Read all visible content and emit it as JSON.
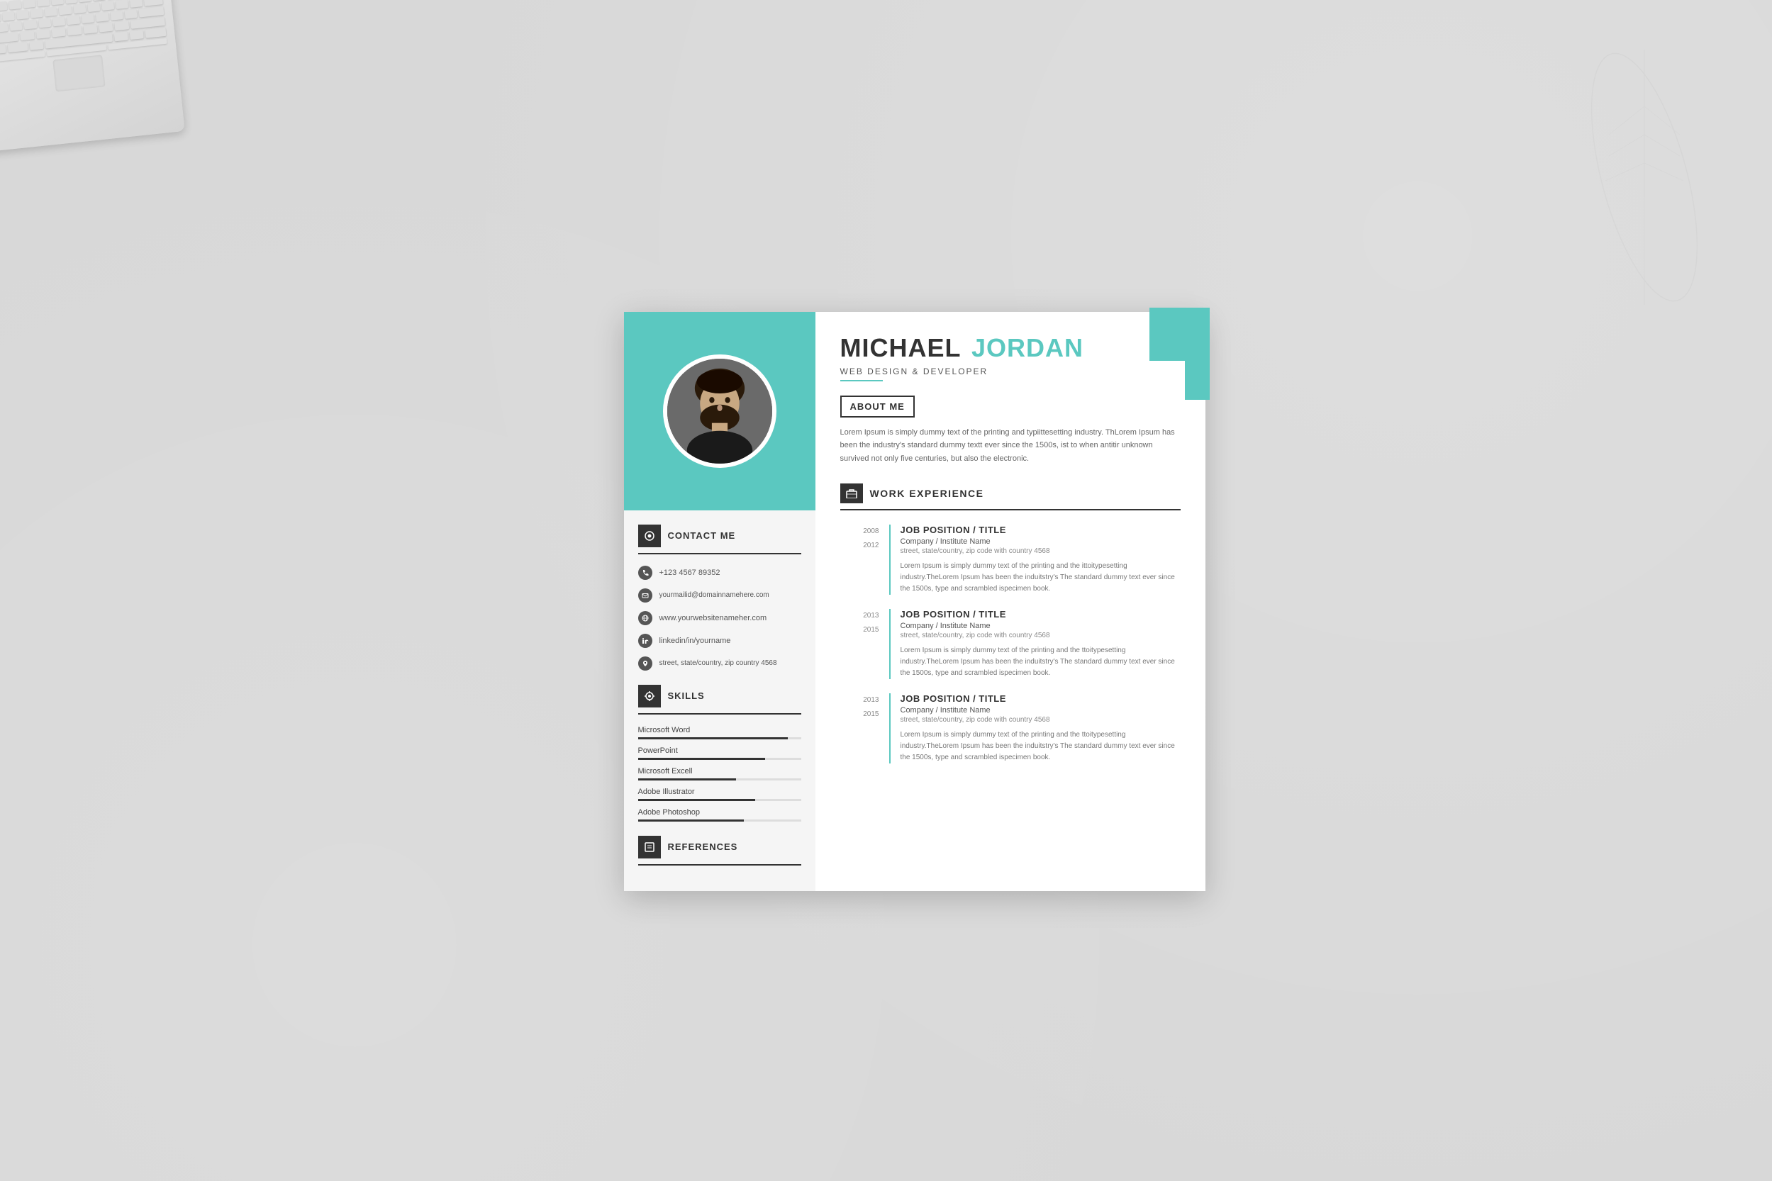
{
  "resume": {
    "name": {
      "first": "MICHAEL",
      "last": "JORDAN"
    },
    "job_title": "WEB DESIGN & DEVELOPER",
    "about_me": {
      "label": "ABOUT ME",
      "text": "Lorem Ipsum is simply dummy text of the printing and typiittesetting industry. ThLorem Ipsum has been the industry's standard dummy textt ever since the 1500s, ist to when antitir unknown survived not only five centuries, but also the  electronic."
    },
    "contact": {
      "section_label": "CONTACT ME",
      "items": [
        {
          "icon": "phone",
          "value": "+123 4567 89352"
        },
        {
          "icon": "email",
          "value": "yourmailid@domainnamehere.com"
        },
        {
          "icon": "web",
          "value": "www.yourwebsitenameher.com"
        },
        {
          "icon": "linkedin",
          "value": "linkedin/in/yourname"
        },
        {
          "icon": "location",
          "value": "street, state/country, zip country 4568"
        }
      ]
    },
    "skills": {
      "section_label": "SKILLS",
      "items": [
        {
          "name": "Microsoft Word",
          "percent": 92
        },
        {
          "name": "PowerPoint",
          "percent": 78
        },
        {
          "name": "Microsoft Excell",
          "percent": 60
        },
        {
          "name": "Adobe Illustrator",
          "percent": 72
        },
        {
          "name": "Adobe Photoshop",
          "percent": 65
        }
      ]
    },
    "references": {
      "section_label": "REFERENCES"
    },
    "work_experience": {
      "section_label": "WORK EXPERIENCE",
      "jobs": [
        {
          "year_start": "2008",
          "year_end": "2012",
          "position": "JOB POSITION / TITLE",
          "company": "Company / Institute Name",
          "address": "street, state/country, zip code with country 4568",
          "description": "Lorem Ipsum is simply dummy text of the printing and the ittoitypesetting industry.TheLorem Ipsum has been the induitstry's The standard dummy text ever since the 1500s, type and scrambled ispecimen book."
        },
        {
          "year_start": "2013",
          "year_end": "2015",
          "position": "JOB POSITION / TITLE",
          "company": "Company / Institute Name",
          "address": "street, state/country, zip code with country 4568",
          "description": "Lorem Ipsum is simply dummy text of the printing and the ttoitypesetting industry.TheLorem Ipsum has been the induitstry's The standard dummy text ever since the 1500s, type and scrambled ispecimen book."
        },
        {
          "year_start": "2013",
          "year_end": "2015",
          "position": "JOB POSITION / TITLE",
          "company": "Company / Institute Name",
          "address": "street, state/country, zip code with country 4568",
          "description": "Lorem Ipsum is simply dummy text of the printing and the ttoitypesetting industry.TheLorem Ipsum has been the induitstry's The standard dummy text ever since the 1500s, type and scrambled ispecimen book."
        }
      ]
    }
  },
  "colors": {
    "teal": "#5bc8c0",
    "dark": "#333333",
    "light_bg": "#f5f5f5",
    "text_medium": "#666666",
    "text_light": "#888888"
  }
}
